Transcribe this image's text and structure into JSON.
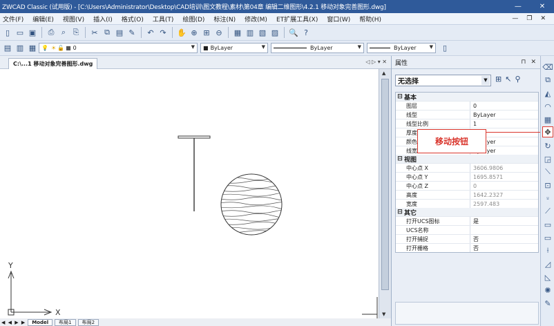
{
  "title_bar": {
    "title": "ZWCAD Classic (试用版) - [C:\\Users\\Administrator\\Desktop\\CAD培训\\图文教程\\素材\\第04章 编辑二维图形\\4.2.1 移动对象完善图形.dwg]",
    "minimize": "—",
    "close": "✕"
  },
  "menu": {
    "items": [
      "文件(F)",
      "编辑(E)",
      "视图(V)",
      "插入(I)",
      "格式(O)",
      "工具(T)",
      "绘图(D)",
      "标注(N)",
      "修改(M)",
      "ET扩展工具(X)",
      "窗口(W)",
      "帮助(H)"
    ],
    "mdi_controls": [
      "—",
      "❐",
      "✕"
    ]
  },
  "toolbar2": {
    "layer_value": "0",
    "color_value": "ByLayer",
    "linetype_value": "ByLayer",
    "lineweight_value": "ByLayer"
  },
  "document": {
    "tab_label": "C:\\...1 移动对象完善图形.dwg",
    "tab_nav": "◁ ▷ ▾ ✕",
    "ucs_x": "X",
    "ucs_y": "Y",
    "layout_nav": "◀ ◀ ▶ ▶",
    "layout_tabs": [
      "Model",
      "布局1",
      "布局2"
    ]
  },
  "properties": {
    "title": "属性",
    "controls": [
      "⊓",
      "✕"
    ],
    "selection": "无选择",
    "groups": [
      {
        "name": "基本",
        "toggle": "⊟",
        "rows": [
          {
            "k": "图层",
            "v": "0",
            "dim": false
          },
          {
            "k": "线型",
            "v": "ByLayer",
            "dim": false
          },
          {
            "k": "线型比例",
            "v": "1",
            "dim": false
          },
          {
            "k": "厚度",
            "v": "",
            "dim": false
          },
          {
            "k": "颜色",
            "v": "ByLayer",
            "dim": false
          },
          {
            "k": "线宽",
            "v": "ByLayer",
            "dim": false
          }
        ]
      },
      {
        "name": "视图",
        "toggle": "⊟",
        "rows": [
          {
            "k": "中心点 X",
            "v": "3606.9806",
            "dim": true
          },
          {
            "k": "中心点 Y",
            "v": "1695.8571",
            "dim": true
          },
          {
            "k": "中心点 Z",
            "v": "0",
            "dim": true
          },
          {
            "k": "高度",
            "v": "1642.2327",
            "dim": true
          },
          {
            "k": "宽度",
            "v": "2597.483",
            "dim": true
          }
        ]
      },
      {
        "name": "其它",
        "toggle": "⊟",
        "rows": [
          {
            "k": "打开UCS图标",
            "v": "是",
            "dim": false
          },
          {
            "k": "UCS名称",
            "v": "",
            "dim": false
          },
          {
            "k": "打开捕捉",
            "v": "否",
            "dim": false
          },
          {
            "k": "打开栅格",
            "v": "否",
            "dim": false
          }
        ]
      }
    ]
  },
  "callout": {
    "text": "移动按钮",
    "color": "#d9342b"
  },
  "colors": {
    "titlebar": "#2f5a9a",
    "accent_red": "#d9342b"
  }
}
